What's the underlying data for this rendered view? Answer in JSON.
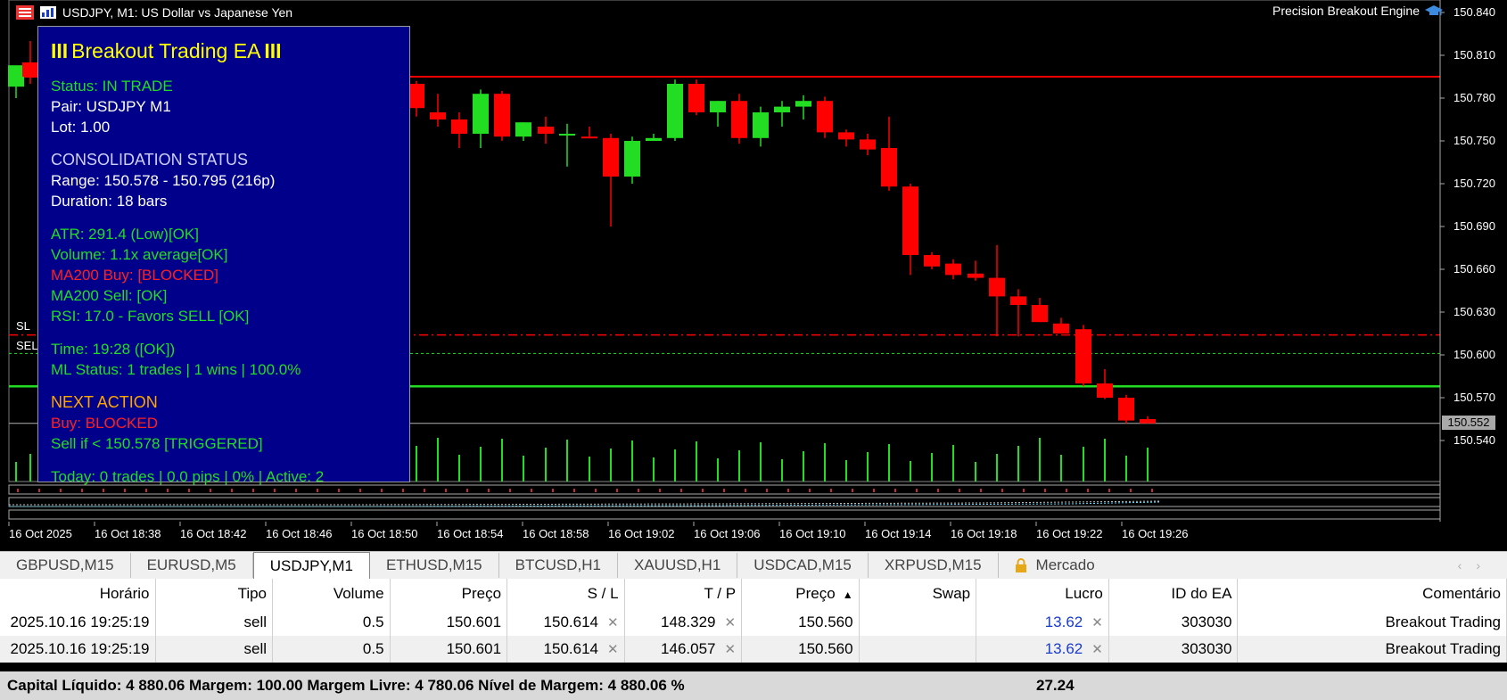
{
  "window": {
    "title": "USDJPY, M1:  US Dollar vs Japanese Yen",
    "brand": "Precision Breakout Engine"
  },
  "ea_panel": {
    "title": "Breakout Trading EA",
    "title_marks": "III",
    "status": "Status: IN TRADE",
    "pair": "Pair: USDJPY M1",
    "lot": "Lot: 1.00",
    "consolidation_heading": "CONSOLIDATION STATUS",
    "range": "Range: 150.578 - 150.795 (216p)",
    "duration": "Duration: 18 bars",
    "atr": "ATR: 291.4 (Low)[OK]",
    "volume": "Volume: 1.1x average[OK]",
    "ma200_buy": "MA200 Buy: [BLOCKED]",
    "ma200_sell": "MA200 Sell: [OK]",
    "rsi": "RSI: 17.0 - Favors SELL [OK]",
    "time": "Time: 19:28 ([OK])",
    "ml_status": "ML Status: 1 trades | 1 wins | 100.0%",
    "next_action_heading": "NEXT ACTION",
    "buy_action": "Buy: BLOCKED",
    "sell_action": "Sell if < 150.578 [TRIGGERED]",
    "today": "Today: 0 trades | 0.0 pips | 0% | Active: 2"
  },
  "chart": {
    "sl_label": "SL",
    "sell_label": "SEL",
    "current_price": "150.552",
    "price_axis": [
      "150.840",
      "150.810",
      "150.780",
      "150.750",
      "150.720",
      "150.690",
      "150.660",
      "150.630",
      "150.600",
      "150.570",
      "150.540"
    ],
    "time_axis": [
      "16 Oct 2025",
      "16 Oct 18:38",
      "16 Oct 18:42",
      "16 Oct 18:46",
      "16 Oct 18:50",
      "16 Oct 18:54",
      "16 Oct 18:58",
      "16 Oct 19:02",
      "16 Oct 19:06",
      "16 Oct 19:10",
      "16 Oct 19:14",
      "16 Oct 19:18",
      "16 Oct 19:22",
      "16 Oct 19:26"
    ],
    "colors": {
      "bull": "#22dd22",
      "bear": "#ff0000",
      "resistance": "#ff0000",
      "support": "#22dd22",
      "stop_loss": "#ff0000",
      "entry": "#22dd22",
      "current": "#b0b0b0"
    }
  },
  "tabs": [
    {
      "label": "GBPUSD,M15",
      "active": false
    },
    {
      "label": "EURUSD,M5",
      "active": false
    },
    {
      "label": "USDJPY,M1",
      "active": true
    },
    {
      "label": "ETHUSD,M15",
      "active": false
    },
    {
      "label": "BTCUSD,H1",
      "active": false
    },
    {
      "label": "XAUUSD,H1",
      "active": false
    },
    {
      "label": "USDCAD,M15",
      "active": false
    },
    {
      "label": "XRPUSD,M15",
      "active": false
    },
    {
      "label": "Mercado",
      "active": false,
      "icon": "lock-icon"
    }
  ],
  "table": {
    "columns": [
      "Horário",
      "Tipo",
      "Volume",
      "Preço",
      "S / L",
      "T / P",
      "Preço",
      "Swap",
      "Lucro",
      "ID do EA",
      "Comentário"
    ],
    "rows": [
      {
        "time": "2025.10.16 19:25:19",
        "type": "sell",
        "volume": "0.5",
        "price": "150.601",
        "sl": "150.614",
        "tp": "148.329",
        "current": "150.560",
        "swap": "",
        "profit": "13.62",
        "ea_id": "303030",
        "comment": "Breakout Trading"
      },
      {
        "time": "2025.10.16 19:25:19",
        "type": "sell",
        "volume": "0.5",
        "price": "150.601",
        "sl": "150.614",
        "tp": "146.057",
        "current": "150.560",
        "swap": "",
        "profit": "13.62",
        "ea_id": "303030",
        "comment": "Breakout Trading"
      }
    ]
  },
  "status_bar": {
    "text": "Capital Líquido: 4 880.06  Margem: 100.00  Margem Livre: 4 780.06  Nível de Margem: 4 880.06 %",
    "total_profit": "27.24"
  }
}
